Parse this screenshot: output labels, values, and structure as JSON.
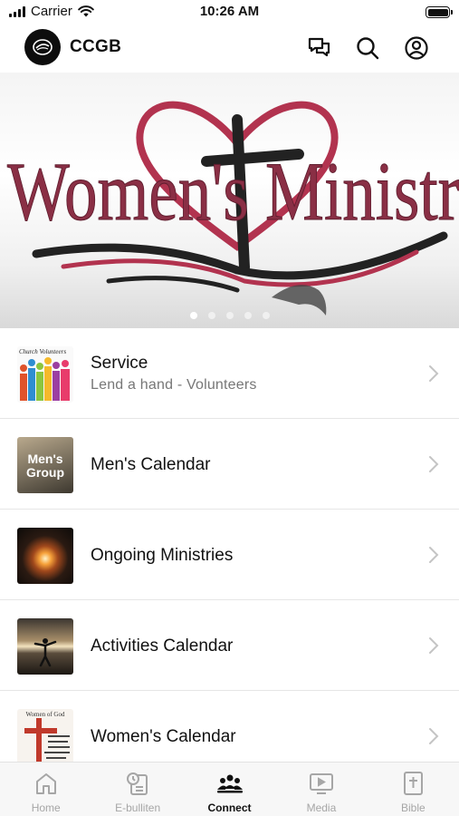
{
  "status_bar": {
    "carrier": "Carrier",
    "time": "10:26 AM"
  },
  "header": {
    "title": "CCGB",
    "icons": [
      "chat-icon",
      "search-icon",
      "profile-icon"
    ]
  },
  "banner": {
    "text": "Women's Ministr",
    "slide_count": 5,
    "active_slide": 1,
    "colors": {
      "text": "#8a2f45",
      "heart": "#b2334f",
      "cross": "#222222"
    }
  },
  "list": {
    "items": [
      {
        "title": "Service",
        "subtitle": "Lend a hand - Volunteers",
        "thumb_text": "Church Volunteers"
      },
      {
        "title": "Men's Calendar",
        "thumb_text_1": "Men's",
        "thumb_text_2": "Group"
      },
      {
        "title": "Ongoing Ministries"
      },
      {
        "title": "Activities Calendar"
      },
      {
        "title": "Women's Calendar",
        "thumb_text": "Women of God"
      }
    ]
  },
  "tabs": [
    {
      "label": "Home",
      "icon": "home-icon",
      "active": false
    },
    {
      "label": "E-bulliten",
      "icon": "bulletin-icon",
      "active": false
    },
    {
      "label": "Connect",
      "icon": "connect-icon",
      "active": true
    },
    {
      "label": "Media",
      "icon": "media-icon",
      "active": false
    },
    {
      "label": "Bible",
      "icon": "bible-icon",
      "active": false
    }
  ]
}
